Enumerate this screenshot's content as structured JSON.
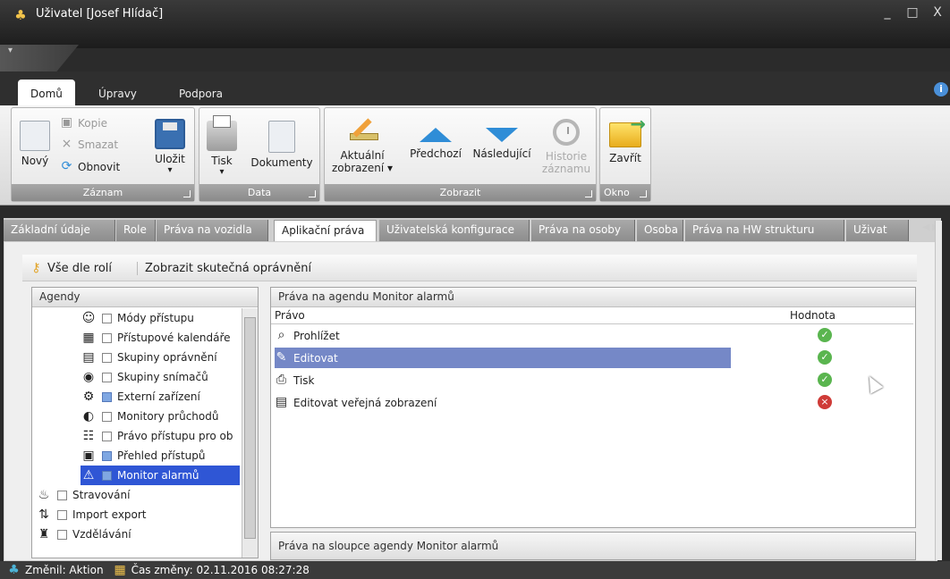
{
  "window": {
    "title": "Uživatel [Josef Hlídač]",
    "controls": [
      "_",
      "□",
      "X"
    ]
  },
  "ribbon_tabs": [
    "Domů",
    "Úpravy",
    "Podpora"
  ],
  "ribbon": {
    "groups": {
      "zaznam": "Záznam",
      "data": "Data",
      "zobrazit": "Zobrazit",
      "okno": "Okno"
    },
    "buttons": {
      "novy": "Nový",
      "kopie": "Kopie",
      "smazat": "Smazat",
      "obnovit": "Obnovit",
      "ulozit": "Uložit",
      "tisk": "Tisk",
      "dokumenty": "Dokumenty",
      "aktualni": "Aktuální",
      "zobrazeni": "zobrazení ▾",
      "predchozi": "Předchozí",
      "nasledujici": "Následující",
      "historie": "Historie",
      "zaznamu": "záznamu",
      "zavrit": "Zavřít"
    }
  },
  "tabs": [
    "Základní údaje",
    "Role",
    "Práva na vozidla",
    "Aplikační práva",
    "Uživatelská konfigurace",
    "Práva na osoby",
    "Osoba",
    "Práva na HW strukturu",
    "Uživat"
  ],
  "toolbar": {
    "all_by_roles": "Vše dle rolí",
    "show_real_permissions": "Zobrazit skutečná oprávnění"
  },
  "agendy": {
    "title": "Agendy",
    "items": [
      {
        "label": "Módy přístupu",
        "icon": "user-icon",
        "checked": false
      },
      {
        "label": "Přístupové kalendáře",
        "icon": "calendar-icon",
        "checked": false
      },
      {
        "label": "Skupiny oprávnění",
        "icon": "group-icon",
        "checked": false
      },
      {
        "label": "Skupiny snímačů",
        "icon": "sensor-icon",
        "checked": false
      },
      {
        "label": "Externí zařízení",
        "icon": "device-icon",
        "checked": true
      },
      {
        "label": "Monitory průchodů",
        "icon": "monitor-icon",
        "checked": false
      },
      {
        "label": "Právo přístupu pro ob",
        "icon": "hierarchy-icon",
        "checked": false
      },
      {
        "label": "Přehled přístupů",
        "icon": "access-icon",
        "checked": true
      },
      {
        "label": "Monitor alarmů",
        "icon": "alarm-icon",
        "checked": true
      },
      {
        "label": "Stravování",
        "icon": "meal-icon",
        "checked": false
      },
      {
        "label": "Import export",
        "icon": "import-icon",
        "checked": false
      },
      {
        "label": "Vzdělávání",
        "icon": "education-icon",
        "checked": false
      }
    ]
  },
  "rights": {
    "title": "Práva na agendu Monitor alarmů",
    "columns": {
      "pravo": "Právo",
      "hodnota": "Hodnota"
    },
    "rows": [
      {
        "pravo": "Prohlížet",
        "status": "ok",
        "icon": "magnifier-icon"
      },
      {
        "pravo": "Editovat",
        "status": "ok",
        "icon": "edit-icon"
      },
      {
        "pravo": "Tisk",
        "status": "ok",
        "icon": "printer-icon"
      },
      {
        "pravo": "Editovat veřejná zobrazení",
        "status": "no",
        "icon": "public-edit-icon"
      }
    ],
    "ok_symbol": "✓",
    "no_symbol": "×"
  },
  "columns_panel": {
    "title": "Práva na sloupce agendy Monitor alarmů"
  },
  "status": {
    "changed_by": "Změnil: Aktion",
    "change_time": "Čas změny: 02.11.2016 08:27:28"
  },
  "colors": {
    "accent": "#2f56d5",
    "selected_row": "#7588c7",
    "ok": "#5ab54f",
    "error": "#cf3b37"
  }
}
